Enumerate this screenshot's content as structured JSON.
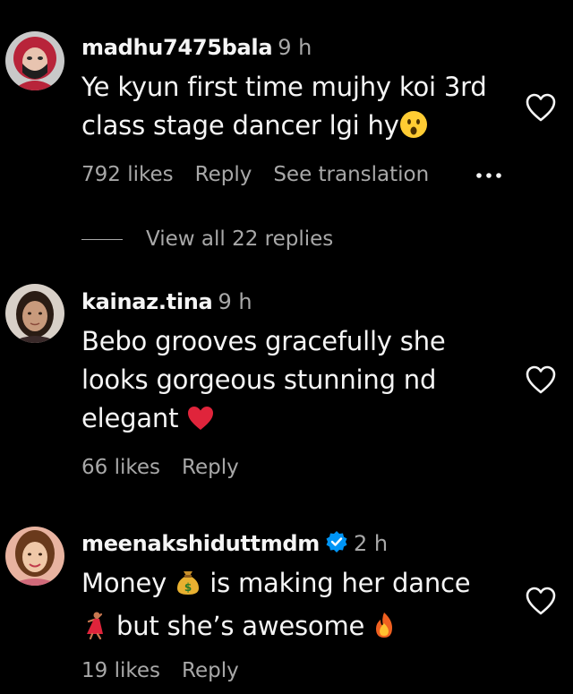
{
  "comments": [
    {
      "username": "madhu7475bala",
      "time": "9 h",
      "text_line1": "Ye kyun first time mujhy koi 3rd",
      "text_line2": "class stage dancer lgi hy",
      "likes": "792 likes",
      "reply": "Reply",
      "see_translation": "See translation",
      "more_icon": "more-dots-icon",
      "like_icon": "heart-outline-icon",
      "emoji_end": "astonished-face-emoji",
      "view_replies": "View all 22 replies"
    },
    {
      "username": "kainaz.tina",
      "time": "9 h",
      "text_line1": "Bebo grooves gracefully she",
      "text_line2": "looks gorgeous stunning nd",
      "text_line3": "elegant",
      "likes": "66 likes",
      "reply": "Reply",
      "like_icon": "heart-outline-icon",
      "emoji_end": "red-heart-emoji"
    },
    {
      "username": "meenakshiduttmdm",
      "verified": true,
      "time": "2 h",
      "text_line1_a": "Money",
      "text_line1_b": "is making her dance",
      "text_line2": "but she’s awesome",
      "likes": "19 likes",
      "reply": "Reply",
      "like_icon": "heart-outline-icon",
      "emoji_money": "money-bag-emoji",
      "emoji_dancer": "dancer-emoji",
      "emoji_fire": "fire-emoji"
    }
  ],
  "colors": {
    "background": "#000000",
    "primary_text": "#f5f5f5",
    "secondary_text": "#a8a8a8",
    "verified_badge": "#0095f6",
    "heart_emoji": "#e0243b"
  }
}
